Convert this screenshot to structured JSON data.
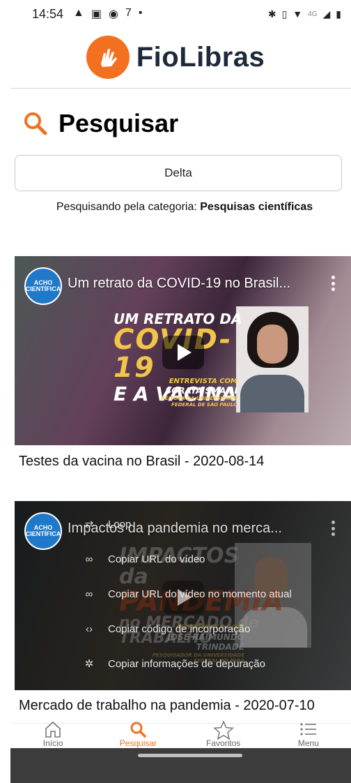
{
  "status_bar": {
    "time": "14:54",
    "left_icons": [
      "warning-icon",
      "sd-card-icon",
      "data-saver-icon",
      "seven-icon",
      "dot-icon"
    ],
    "right_icons": [
      "bluetooth-icon",
      "vibrate-icon",
      "wifi-icon",
      "4g-icon",
      "signal-icon",
      "battery-icon"
    ],
    "network": "4G"
  },
  "brand": {
    "name": "FioLibras",
    "logo_color": "#f37021",
    "logo_icon": "sign-language-hand-icon"
  },
  "page": {
    "title": "Pesquisar",
    "title_icon": "search-icon",
    "accent": "#f37021"
  },
  "search": {
    "value": "Delta"
  },
  "category": {
    "prefix": "Pesquisando pela categoria:",
    "name": "Pesquisas científicas"
  },
  "videos": [
    {
      "overlay_title": "Um retrato da COVID-19 no Brasil...",
      "channel": "ACHO CIENTÍFICA",
      "thumb_line1": "UM RETRATO DA",
      "thumb_line2": "COVID-19",
      "thumb_line3": "E A VACINA",
      "interview_label": "ENTREVISTA COM",
      "interview_name": "SORAYA SMAILI",
      "interview_role": "REITORA DA UNIVERSIDADE FEDERAL DE SÃO PAULO",
      "caption": "Testes da vacina no Brasil - 2020-08-14"
    },
    {
      "overlay_title": "Impactos da pandemia no merca...",
      "channel": "ACHO CIENTÍFICA",
      "thumb_line1": "IMPACTOS da",
      "thumb_line2": "PANDEMIA",
      "thumb_line3": "no MERCADO de TRABALHO",
      "interview_label": "ENTREVISTA COM",
      "interview_name": "JOSÉ RAIMUNDO TRINDADE",
      "interview_role": "PESQUISADOR DA UNIVERSIDADE FEDERAL DO PARÁ",
      "context_menu": [
        {
          "label": "Loop",
          "icon": "loop-icon"
        },
        {
          "label": "Copiar URL do vídeo",
          "icon": "link-icon"
        },
        {
          "label": "Copiar URL do vídeo no momento atual",
          "icon": "link-icon"
        },
        {
          "label": "Copiar código de incorporação",
          "icon": "embed-code-icon"
        },
        {
          "label": "Copiar informações de depuração",
          "icon": "bug-icon"
        }
      ],
      "caption": "Mercado de trabalho na pandemia - 2020-07-10"
    }
  ],
  "bottom_nav": [
    {
      "label": "Início",
      "icon": "home-icon",
      "active": false
    },
    {
      "label": "Pesquisar",
      "icon": "search-icon",
      "active": true
    },
    {
      "label": "Favoritos",
      "icon": "star-icon",
      "active": false
    },
    {
      "label": "Menu",
      "icon": "menu-list-icon",
      "active": false
    }
  ]
}
